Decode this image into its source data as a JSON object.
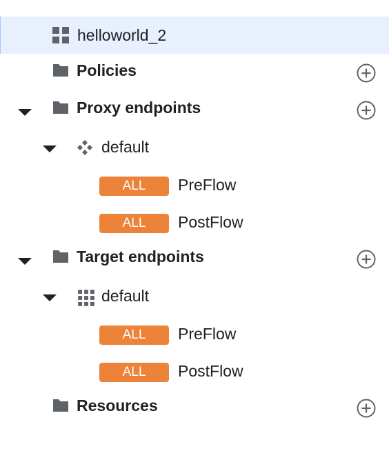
{
  "colors": {
    "selected_bg": "#e8f0fe",
    "badge": "#ec8338",
    "icon": "#5f6368"
  },
  "tree": {
    "root": {
      "label": "helloworld_2",
      "icon": "apps-grid-icon"
    },
    "policies": {
      "label": "Policies",
      "icon": "folder-icon"
    },
    "proxy_endpoints": {
      "label": "Proxy endpoints",
      "icon": "folder-icon",
      "expanded": true,
      "children": [
        {
          "label": "default",
          "icon": "proxy-diamond-icon",
          "expanded": true,
          "flows": [
            {
              "badge": "ALL",
              "label": "PreFlow"
            },
            {
              "badge": "ALL",
              "label": "PostFlow"
            }
          ]
        }
      ]
    },
    "target_endpoints": {
      "label": "Target endpoints",
      "icon": "folder-icon",
      "expanded": true,
      "children": [
        {
          "label": "default",
          "icon": "target-grid-icon",
          "expanded": true,
          "flows": [
            {
              "badge": "ALL",
              "label": "PreFlow"
            },
            {
              "badge": "ALL",
              "label": "PostFlow"
            }
          ]
        }
      ]
    },
    "resources": {
      "label": "Resources",
      "icon": "folder-icon"
    }
  }
}
